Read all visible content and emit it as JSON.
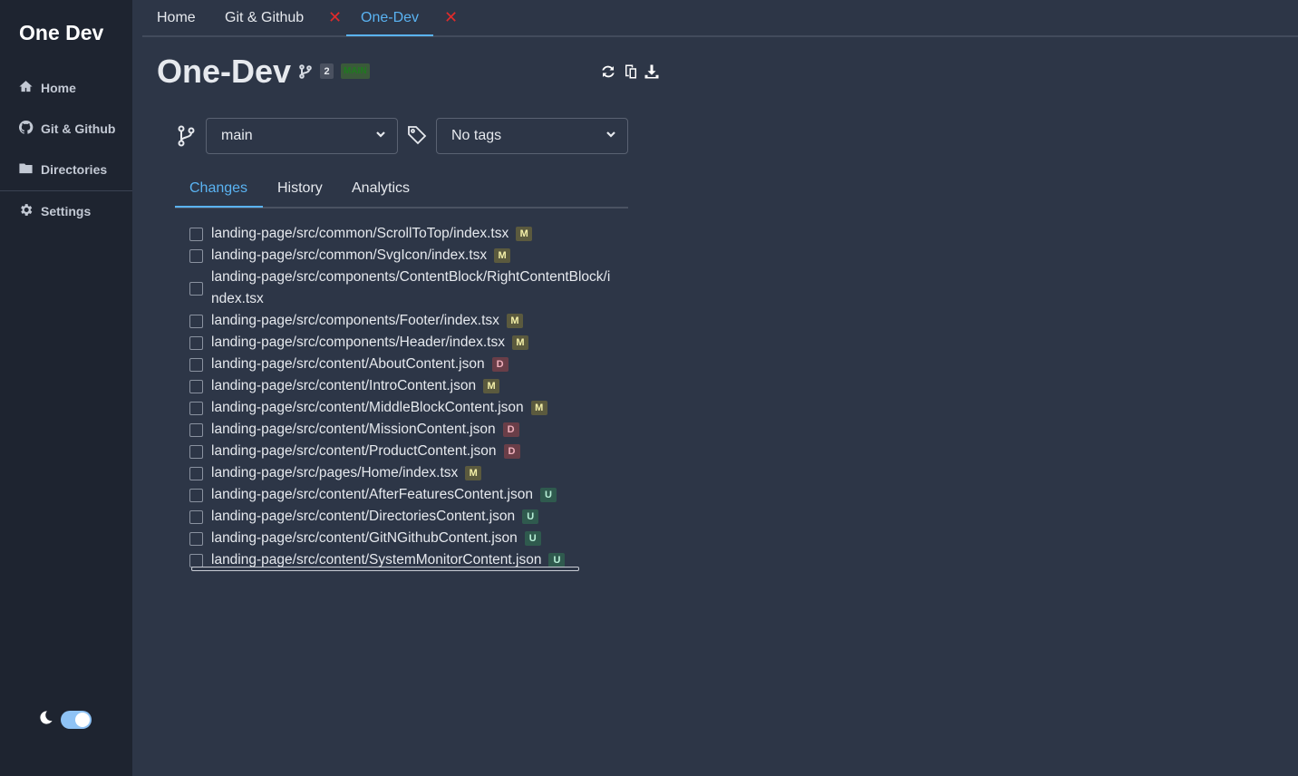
{
  "sidebar": {
    "brand": "One Dev",
    "items": [
      {
        "label": "Home",
        "icon": "home-icon"
      },
      {
        "label": "Git & Github",
        "icon": "github-icon"
      },
      {
        "label": "Directories",
        "icon": "folder-icon"
      },
      {
        "label": "Settings",
        "icon": "gear-icon"
      }
    ],
    "theme_toggle": {
      "icon": "moon-icon",
      "on": true
    }
  },
  "tabs": [
    {
      "label": "Home",
      "active": false,
      "closable": false
    },
    {
      "label": "Git & Github",
      "active": false,
      "closable": true
    },
    {
      "label": "One-Dev",
      "active": true,
      "closable": true
    }
  ],
  "tab_close_glyph": "✕",
  "header": {
    "title": "One-Dev",
    "branch_count": "2",
    "current_branch_badge": "MAIN",
    "actions": [
      "refresh-icon",
      "copy-icon",
      "download-icon"
    ]
  },
  "selectors": {
    "branch": {
      "value": "main",
      "icon": "git-branch-icon"
    },
    "tags": {
      "value": "No tags",
      "icon": "tag-icon"
    }
  },
  "subtabs": [
    {
      "label": "Changes",
      "active": true
    },
    {
      "label": "History",
      "active": false
    },
    {
      "label": "Analytics",
      "active": false
    }
  ],
  "changes": [
    {
      "path": "landing-page/src/common/ScrollToTop/index.tsx",
      "status": "M"
    },
    {
      "path": "landing-page/src/common/SvgIcon/index.tsx",
      "status": "M"
    },
    {
      "path": "landing-page/src/components/ContentBlock/RightContentBlock/index.tsx",
      "status": "M",
      "wrapped": true
    },
    {
      "path": "landing-page/src/components/Footer/index.tsx",
      "status": "M"
    },
    {
      "path": "landing-page/src/components/Header/index.tsx",
      "status": "M"
    },
    {
      "path": "landing-page/src/content/AboutContent.json",
      "status": "D"
    },
    {
      "path": "landing-page/src/content/IntroContent.json",
      "status": "M"
    },
    {
      "path": "landing-page/src/content/MiddleBlockContent.json",
      "status": "M"
    },
    {
      "path": "landing-page/src/content/MissionContent.json",
      "status": "D"
    },
    {
      "path": "landing-page/src/content/ProductContent.json",
      "status": "D"
    },
    {
      "path": "landing-page/src/pages/Home/index.tsx",
      "status": "M"
    },
    {
      "path": "landing-page/src/content/AfterFeaturesContent.json",
      "status": "U"
    },
    {
      "path": "landing-page/src/content/DirectoriesContent.json",
      "status": "U"
    },
    {
      "path": "landing-page/src/content/GitNGithubContent.json",
      "status": "U"
    },
    {
      "path": "landing-page/src/content/SystemMonitorContent.json",
      "status": "U"
    }
  ]
}
